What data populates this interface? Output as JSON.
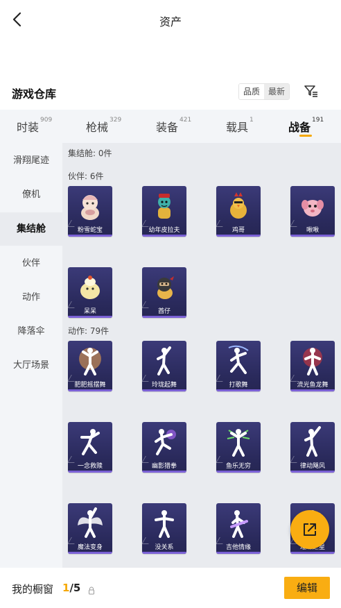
{
  "header": {
    "title": "资产",
    "back_icon": "back-arrow-icon"
  },
  "section": {
    "title": "游戏仓库",
    "sort": [
      "品质",
      "最新"
    ],
    "filter_icon": "filter-icon"
  },
  "tabs": [
    {
      "label": "时装",
      "count": "909"
    },
    {
      "label": "枪械",
      "count": "329"
    },
    {
      "label": "装备",
      "count": "421"
    },
    {
      "label": "载具",
      "count": "1"
    },
    {
      "label": "战备",
      "count": "191",
      "active": true
    }
  ],
  "sidebar": [
    {
      "label": "滑翔尾迹"
    },
    {
      "label": "僚机"
    },
    {
      "label": "集结舱",
      "active": true
    },
    {
      "label": "伙伴"
    },
    {
      "label": "动作"
    },
    {
      "label": "降落伞"
    },
    {
      "label": "大厅场景"
    }
  ],
  "groups": {
    "pod": {
      "label": "集结舱: 0件"
    },
    "companion": {
      "label": "伙伴: 6件",
      "items": [
        "粉雪蛇宝",
        "幼年皮拉夫",
        "鸡哥",
        "啾啾",
        "呆呆",
        "酋仔"
      ]
    },
    "emote": {
      "label": "动作: 79件",
      "items": [
        "肥肥摇摆舞",
        "玲珑起舞",
        "打歌舞",
        "流光鱼龙舞",
        "一念救赎",
        "幽影猎拳",
        "鱼乐无穷",
        "律动飓风",
        "魔法变身",
        "没关系",
        "吉他情缘",
        "璀璨之星"
      ]
    }
  },
  "fab": {
    "icon": "share-external-icon"
  },
  "bottom": {
    "label": "我的橱窗",
    "current": "1",
    "total": "/5",
    "lock_icon": "lock-icon",
    "edit_label": "编辑"
  },
  "colors": {
    "accent": "#f9ad12",
    "card_bg": "#2f2e66",
    "card_stripe": "#7b61d6"
  }
}
